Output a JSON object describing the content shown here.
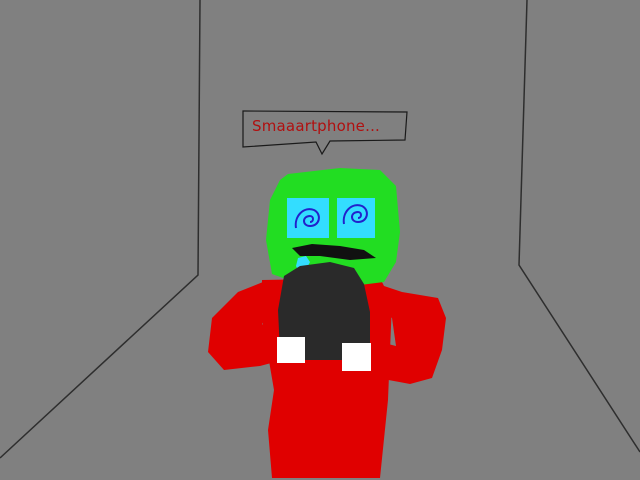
{
  "speech_bubble": {
    "text": "Smaaartphone..."
  },
  "colors": {
    "background": "#808080",
    "wall_lines": "#333333",
    "skin": "#22dd22",
    "body": "#e00000",
    "phone": "#2a2a2a",
    "eyes": "#33ddff",
    "eye_spirals": "#2222cc",
    "hands": "#ffffff",
    "speech_text": "#b01010"
  }
}
